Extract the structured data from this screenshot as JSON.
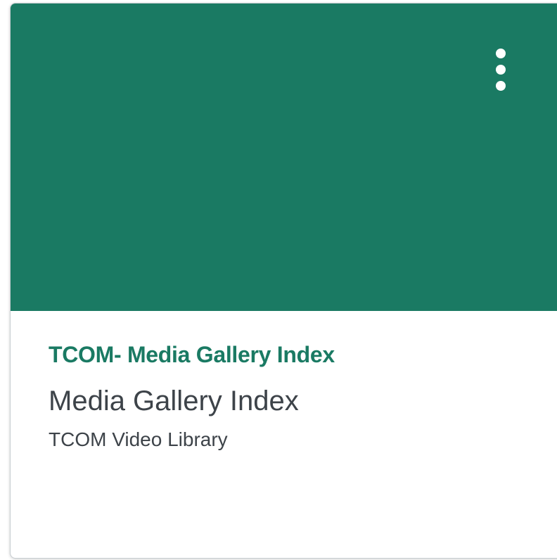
{
  "card": {
    "hero_color": "#1a7a63",
    "accent_color": "#1a7a63",
    "options_icon": "vertical-ellipsis-icon",
    "course_code": "TCOM- Media Gallery Index",
    "title": "Media Gallery Index",
    "term": "TCOM Video Library"
  }
}
